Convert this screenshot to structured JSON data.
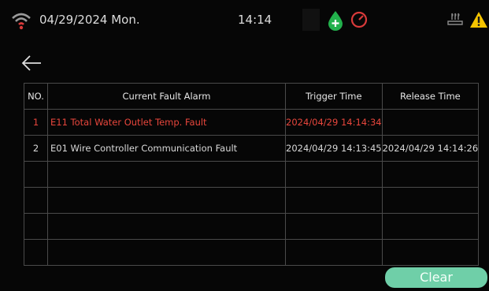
{
  "status": {
    "date": "04/29/2024 Mon.",
    "time": "14:14"
  },
  "icons": {
    "wifi": "wifi-icon",
    "water_drop": "water-drop-plus-icon",
    "gauge": "gauge-icon",
    "heater": "heater-icon",
    "warning": "warning-icon",
    "back": "back-arrow-icon"
  },
  "colors": {
    "active_fault": "#e8463c",
    "drop_green": "#22b14c",
    "gauge_red": "#d93a3a",
    "warning_yellow": "#f5c400",
    "clear_button": "#6fcfa8"
  },
  "table": {
    "headers": {
      "no": "NO.",
      "alarm": "Current Fault Alarm",
      "trigger": "Trigger Time",
      "release": "Release Time"
    },
    "rows": [
      {
        "no": "1",
        "alarm": "E11 Total Water Outlet Temp. Fault",
        "trigger": "2024/04/29 14:14:34",
        "release": ""
      },
      {
        "no": "2",
        "alarm": "E01 Wire Controller Communication Fault",
        "trigger": "2024/04/29 14:13:45",
        "release": "2024/04/29 14:14:26"
      },
      {
        "no": "",
        "alarm": "",
        "trigger": "",
        "release": ""
      },
      {
        "no": "",
        "alarm": "",
        "trigger": "",
        "release": ""
      },
      {
        "no": "",
        "alarm": "",
        "trigger": "",
        "release": ""
      },
      {
        "no": "",
        "alarm": "",
        "trigger": "",
        "release": ""
      }
    ]
  },
  "clear_label": "Clear"
}
